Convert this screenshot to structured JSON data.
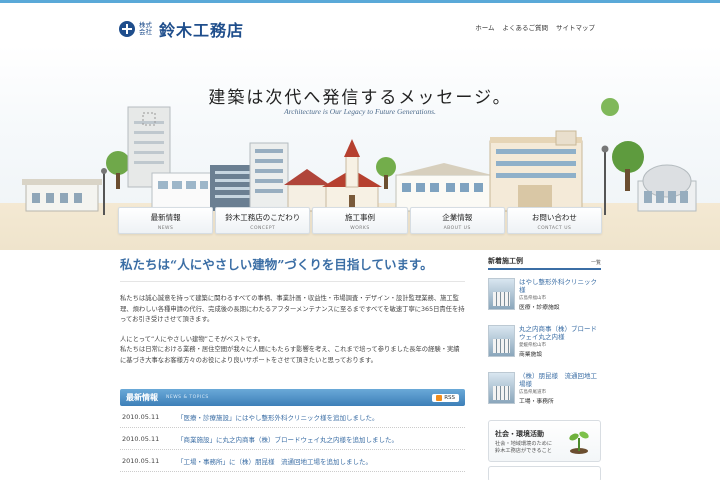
{
  "header": {
    "logo_small": "株式会社",
    "logo_name": "鈴木工務店",
    "topnav": [
      "ホーム",
      "よくあるご質問",
      "サイトマップ"
    ]
  },
  "hero": {
    "title": "建築は次代へ発信するメッセージ。",
    "subtitle": "Architecture is Our Legacy to Future Generations."
  },
  "globalnav": [
    {
      "label": "最新情報",
      "sub": "NEWS"
    },
    {
      "label": "鈴木工務店のこだわり",
      "sub": "CONCEPT"
    },
    {
      "label": "施工事例",
      "sub": "WORKS"
    },
    {
      "label": "企業情報",
      "sub": "ABOUT US"
    },
    {
      "label": "お問い合わせ",
      "sub": "CONTACT US"
    }
  ],
  "main": {
    "catch": "私たちは“人にやさしい建物”づくりを目指しています。",
    "intro1": "私たちは誠心誠意を持って建築に関わるすべての事柄、事業計画・収益性・市場調査・デザイン・設計監理業務、施工監理、煩わしい各種申請の代行、完成後の長期にわたるアフターメンテナンスに至るまですべてを敏速丁寧に365日責任を持ってお引き受けさせて頂きます。",
    "intro2": "人にとって“人にやさしい建物”こそがベストです。",
    "intro3": "私たちは日常における業務・居住空間が我々に人間にもたらす影響を考え、これまで培って参りました長年の経験・実績に基づき大事なお客様方々のお役により良いサポートをさせて頂きたいと思っております。"
  },
  "news": {
    "title": "最新情報",
    "en": "NEWS & TOPICS",
    "rss": "RSS",
    "items": [
      {
        "date": "2010.05.11",
        "text": "「医療・診療施設」にはやし整形外科クリニック様を追加しました。"
      },
      {
        "date": "2010.05.11",
        "text": "「商業施設」に丸之内商事（株）ブロードウェイ丸之内様を追加しました。"
      },
      {
        "date": "2010.05.11",
        "text": "「工場・事務所」に（株）朋昆様　流通回地工場を追加しました。"
      }
    ]
  },
  "side": {
    "title": "新着施工例",
    "more": "一覧",
    "works": [
      {
        "name": "はやし整形外科クリニック様",
        "loc": "広島県福山市",
        "cat": "医療・診療施設"
      },
      {
        "name": "丸之内商事（株）ブロードウェイ丸之内様",
        "loc": "愛媛県松山市",
        "cat": "商業施設"
      },
      {
        "name": "（株）朋昆様　流通回地工場様",
        "loc": "広島県尾道市",
        "cat": "工場・事務所"
      }
    ],
    "eco_title": "社会・環境活動",
    "eco_text1": "社会・地域環境のために",
    "eco_text2": "鈴木工務店ができること"
  }
}
